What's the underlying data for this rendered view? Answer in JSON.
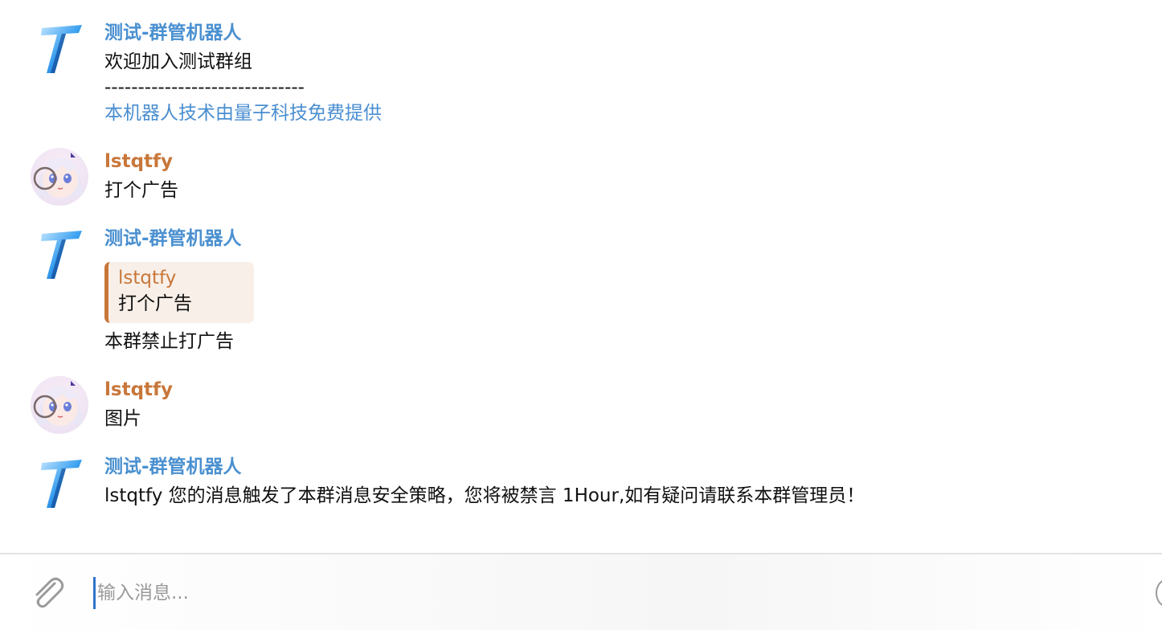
{
  "messages": [
    {
      "sender": "测试-群管机器人",
      "lines": [
        "欢迎加入测试群组",
        "------------------------------",
        "本机器人技术由量子科技免费提供"
      ]
    },
    {
      "sender": "lstqtfy",
      "text": "打个广告"
    },
    {
      "sender": "测试-群管机器人",
      "quote": {
        "sender": "lstqtfy",
        "text": "打个广告"
      },
      "text": "本群禁止打广告"
    },
    {
      "sender": "lstqtfy",
      "text": "图片"
    },
    {
      "sender": "测试-群管机器人",
      "text": "lstqtfy 您的消息触发了本群消息安全策略，您将被禁言 1Hour,如有疑问请联系本群管理员！"
    }
  ],
  "composer": {
    "placeholder": "输入消息...",
    "attach_icon": "paperclip-icon",
    "emoji_icon": "emoji-icon"
  },
  "colors": {
    "bot_name": "#4a90d0",
    "user_name": "#c8773a",
    "link": "#4a8ed0",
    "quote_bg": "#f8efe8",
    "quote_bar": "#c8773a"
  }
}
